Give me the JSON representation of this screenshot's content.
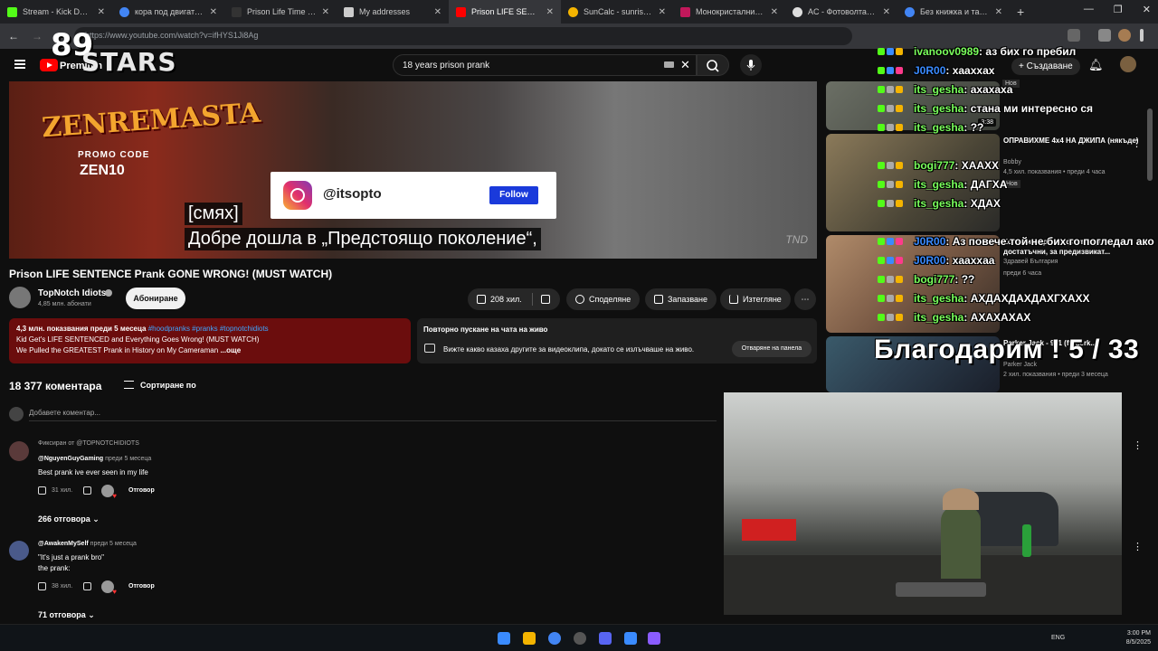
{
  "browser": {
    "tabs": [
      {
        "label": "Stream - Kick Dashboard",
        "color": "#53fc18"
      },
      {
        "label": "кора под двигателя pan",
        "color": "#4285f4"
      },
      {
        "label": "Prison Life Time Senten",
        "color": "#ffffff"
      },
      {
        "label": "My addresses",
        "color": "#cccccc"
      },
      {
        "label": "Prison LIFE SENTENCE P",
        "color": "#ff0000",
        "active": true
      },
      {
        "label": "SunCalc - sunrise, sunse",
        "color": "#f4b400"
      },
      {
        "label": "Монокристални солар",
        "color": "#c2185b"
      },
      {
        "label": "AC - Фотоволтаични и",
        "color": "#dddddd"
      },
      {
        "label": "Без книжка и табели",
        "color": "#4285f4"
      }
    ],
    "url": "https://www.youtube.com/watch?v=ifHYS1Ji8Ag"
  },
  "header": {
    "brand": "Premium",
    "search_query": "18 years prison prank"
  },
  "overlays": {
    "logo_number": "89",
    "logo_text": "STARS"
  },
  "video": {
    "brand_text": "ZENREMASTA",
    "promo_label": "PROMO CODE",
    "promo_code": "ZEN10",
    "ig_handle": "@itsopto",
    "ig_follow": "Follow",
    "subtitle_1": "[смях]",
    "subtitle_2": "Добре дошла в „Предстоящо поколение“,",
    "watermark": "TND",
    "title": "Prison LIFE SENTENCE Prank GONE WRONG! (MUST WATCH)"
  },
  "channel": {
    "name": "TopNotch Idiots",
    "subs": "4,85 млн. абонати",
    "subscribe": "Абониране"
  },
  "actions": {
    "likes": "208 хил.",
    "share": "Споделяне",
    "save": "Запазване",
    "download": "Изтегляне"
  },
  "description": {
    "meta": "4,3 млн. показвания  преди 5 месеца",
    "tags": "#hoodpranks #pranks #topnotchidiots",
    "line2": "Kid Get's LIFE SENTENCED and Everything Goes Wrong! (MUST WATCH)",
    "line3": "We Pulled the GREATEST Prank in History on My Cameraman",
    "more": "...още"
  },
  "chat_replay": {
    "title": "Повторно пускане на чата на живо",
    "text": "Вижте какво казаха другите за видеоклипа, докато се излъчваше на живо.",
    "button": "Отваряне на панела"
  },
  "comments_section": {
    "count": "18 377 коментара",
    "sort": "Сортиране по",
    "placeholder": "Добавете коментар...",
    "items": [
      {
        "pinned": "Фиксиран от @TOPNOTCHIDIOTS",
        "author": "@NguyenGuyGaming",
        "time": "преди 5 месеца",
        "text": "Best prank ive ever seen in my life",
        "likes": "31 хил.",
        "reply": "Отговор",
        "replies": "266 отговора"
      },
      {
        "author": "@AwakenMySelf",
        "time": "преди 5 месеца",
        "text1": "\"It's just a prank bro\"",
        "text2": "the prank:",
        "likes": "38 хил.",
        "reply": "Отговор",
        "replies": "71 отговора"
      }
    ]
  },
  "sidebar": {
    "create": "Създаване",
    "videos": [
      {
        "badge": "Нов",
        "duration": "3:38"
      },
      {
        "title": "ОПРАВИХМЕ 4x4 НА ДЖИПА (някъде)",
        "channel": "Bobby",
        "meta": "4,5 хил. показвания • преди 4 часа",
        "badge": "Нов"
      },
      {
        "title": "Колко интересни факти ще достатъчни, за предизвикат...",
        "channel": "Здравей България",
        "meta": "преди 6 часа"
      },
      {
        "title": "Parker Jack - 911 (ft. Zerk...",
        "channel": "Parker Jack",
        "meta": "2 хил. показвания • преди 3 месеца"
      }
    ]
  },
  "chat_overlay": [
    {
      "user": "ivanoov0989",
      "msg": ": аз бих го пребил",
      "color": "green"
    },
    {
      "user": "J0R00",
      "msg": ": хааххах",
      "color": "blue"
    },
    {
      "user": "its_gesha",
      "msg": ": ахахаха",
      "color": "green"
    },
    {
      "user": "its_gesha",
      "msg": ": стана ми интересно ся",
      "color": "green"
    },
    {
      "user": "its_gesha",
      "msg": ": ??",
      "color": "green"
    },
    {
      "user": "bogi777",
      "msg": ": ХААХХ",
      "color": "green"
    },
    {
      "user": "its_gesha",
      "msg": ": ДАГХА",
      "color": "green"
    },
    {
      "user": "its_gesha",
      "msg": ": ХДАХ",
      "color": "green"
    },
    {
      "user": "J0R00",
      "msg": ": Аз повече той не бих го погледал ако",
      "color": "blue"
    },
    {
      "user": "J0R00",
      "msg": ": хааххаа",
      "color": "blue"
    },
    {
      "user": "bogi777",
      "msg": ": ??",
      "color": "green"
    },
    {
      "user": "its_gesha",
      "msg": ": АХДАХДАХДАХГХАХХ",
      "color": "green"
    },
    {
      "user": "its_gesha",
      "msg": ": АХАХАХАХ",
      "color": "green"
    }
  ],
  "thanks": "Благодарим ! 5 / 33",
  "taskbar": {
    "lang": "ENG",
    "time": "3:00 PM",
    "date": "8/5/2025"
  }
}
